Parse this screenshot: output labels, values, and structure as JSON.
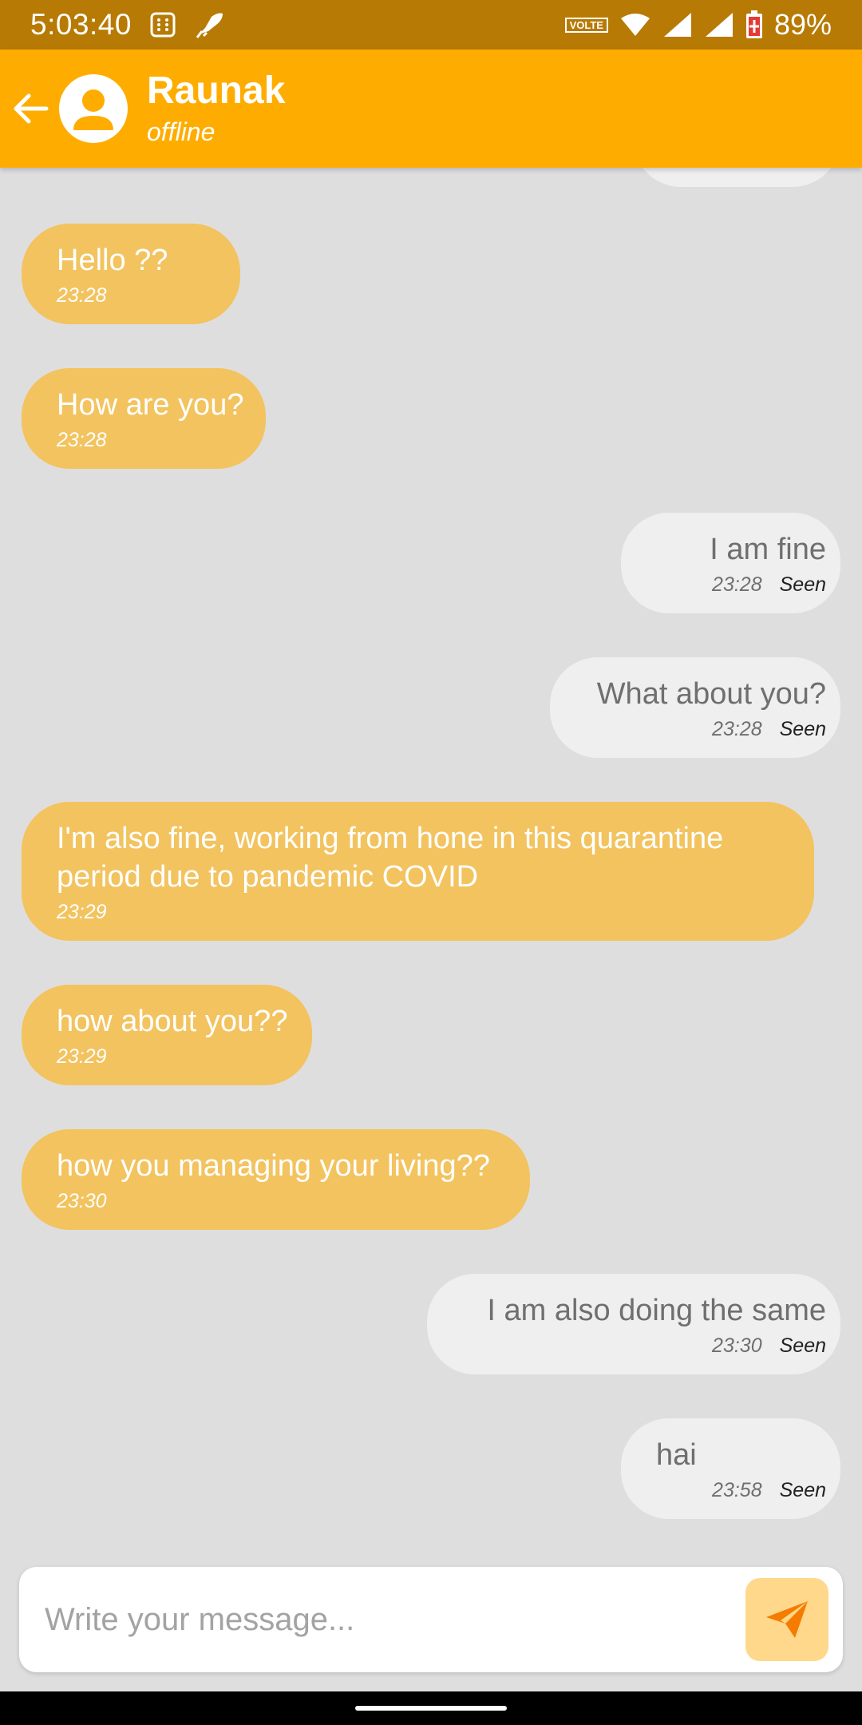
{
  "status_bar": {
    "time": "5:03:40",
    "volte_label": "VOLTE",
    "battery_percent": "89%",
    "icons": [
      "calculator-icon",
      "rocket-icon",
      "volte-icon",
      "wifi-icon",
      "signal-icon",
      "signal-icon",
      "battery-icon"
    ]
  },
  "header": {
    "contact_name": "Raunak",
    "contact_status": "offline",
    "back_icon": "arrow-left-icon",
    "avatar_icon": "person-icon",
    "color": "#FEAD00"
  },
  "messages": [
    {
      "direction": "in",
      "text": "Hello ??",
      "time": "23:28"
    },
    {
      "direction": "in",
      "text": "How are you?",
      "time": "23:28"
    },
    {
      "direction": "out",
      "text": "I am fine",
      "time": "23:28",
      "status": "Seen"
    },
    {
      "direction": "out",
      "text": "What about you?",
      "time": "23:28",
      "status": "Seen"
    },
    {
      "direction": "in",
      "text": "I'm also fine, working from hone in this quarantine period due to pandemic COVID",
      "time": "23:29"
    },
    {
      "direction": "in",
      "text": "how about you??",
      "time": "23:29"
    },
    {
      "direction": "in",
      "text": "how you managing your living??",
      "time": "23:30"
    },
    {
      "direction": "out",
      "text": "I am also doing the same",
      "time": "23:30",
      "status": "Seen"
    },
    {
      "direction": "out",
      "text": "hai",
      "time": "23:58",
      "status": "Seen"
    }
  ],
  "composer": {
    "placeholder": "Write your message...",
    "send_icon": "paper-plane-icon"
  },
  "colors": {
    "incoming_bubble": "#F2C35F",
    "outgoing_bubble": "#EFEFEF",
    "background": "#DFDEDF",
    "status_bar": "#B77A04",
    "send_button": "#FFD88C",
    "send_icon": "#F57C00"
  }
}
